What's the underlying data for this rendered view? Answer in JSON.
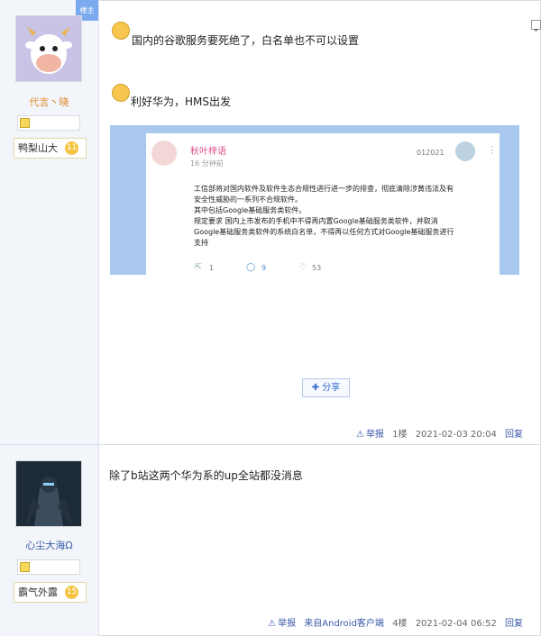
{
  "posts": [
    {
      "author": {
        "name": "代言丶晓",
        "title": "鸭梨山大",
        "level": "11",
        "corner_tag": "楼主"
      },
      "content": {
        "line1": "国内的谷歌服务要死绝了，白名单也不可以设置",
        "line2": "利好华为，HMS出发"
      },
      "embed": {
        "user": "秋叶梓语",
        "time": "16 分钟前",
        "extra": "012021",
        "lines": [
          "工信部将对国内软件及软件生态合规性进行进一步的排查，彻底清除涉黄违法及有",
          "安全性威胁的一系列不合规软件。",
          "其中包括Google基础服务类软件。",
          "规定要求 国内上市发布的手机中不得再内置Google基础服务类软件，并取消",
          "Google基础服务类软件的系统白名单，不得再以任何方式对Google基础服务进行",
          "支持"
        ],
        "stats": {
          "repost": "1",
          "comment": "9",
          "like": "53"
        }
      },
      "share_label": "分享",
      "footer": {
        "report": "举报",
        "floor": "1楼",
        "time": "2021-02-03 20:04",
        "reply": "回复"
      }
    },
    {
      "author": {
        "name": "心尘大海Ω",
        "title": "霸气外露",
        "level": "15"
      },
      "content": {
        "line1": "除了b站这两个华为系的up全站都没消息"
      },
      "footer": {
        "report": "举报",
        "source": "来自Android客户端",
        "floor": "4楼",
        "time": "2021-02-04 06:52",
        "reply": "回复"
      }
    }
  ],
  "colors": {
    "accent_link": "#3a5aa8",
    "level_badge": "#f3c441",
    "embed_bg": "#a9c8f0"
  }
}
